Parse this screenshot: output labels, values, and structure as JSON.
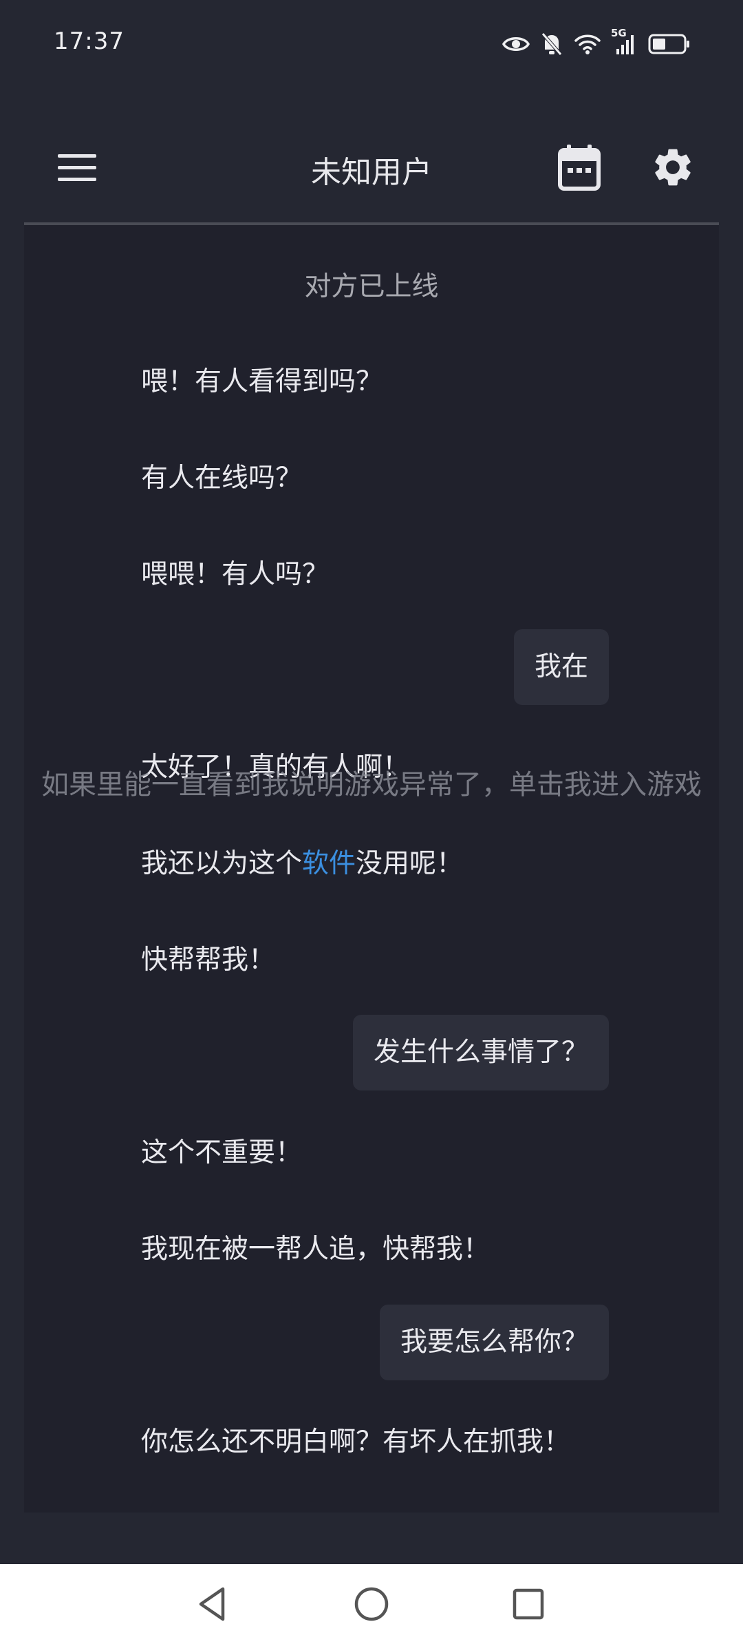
{
  "status_bar": {
    "time": "17:37",
    "network_label": "5G",
    "icons": [
      "eye-icon",
      "bell-muted-icon",
      "wifi-icon",
      "signal-icon",
      "battery-icon"
    ]
  },
  "app_bar": {
    "title": "未知用户",
    "icons": [
      "menu-icon",
      "calendar-icon",
      "gear-icon"
    ]
  },
  "chat": {
    "system_message": "对方已上线",
    "messages": [
      {
        "side": "left",
        "text": "喂！有人看得到吗？"
      },
      {
        "side": "left",
        "text": "有人在线吗？"
      },
      {
        "side": "left",
        "text": "喂喂！有人吗？"
      },
      {
        "side": "right",
        "text": "我在"
      },
      {
        "side": "left",
        "text": "太好了！真的有人啊！"
      },
      {
        "side": "left",
        "text_before": "我还以为这个",
        "link": "软件",
        "text_after": "没用呢！"
      },
      {
        "side": "left",
        "text": "快帮帮我！"
      },
      {
        "side": "right",
        "text": "发生什么事情了？"
      },
      {
        "side": "left",
        "text": "这个不重要！"
      },
      {
        "side": "left",
        "text": "我现在被一帮人追，快帮我！"
      },
      {
        "side": "right",
        "text": "我要怎么帮你？"
      },
      {
        "side": "left",
        "text": "你怎么还不明白啊？有坏人在抓我！"
      }
    ]
  },
  "overlay_banner": "如果里能一直看到我说明游戏异常了，单击我进入游戏",
  "nav_bar": {
    "icons": [
      "back-icon",
      "home-icon",
      "recents-icon"
    ]
  },
  "colors": {
    "background": "#252732",
    "chat_panel": "#20212c",
    "bubble": "#2d2f3b",
    "link": "#3b8fe0",
    "text": "#e9e9ee",
    "muted_text": "#a8a9b0"
  }
}
